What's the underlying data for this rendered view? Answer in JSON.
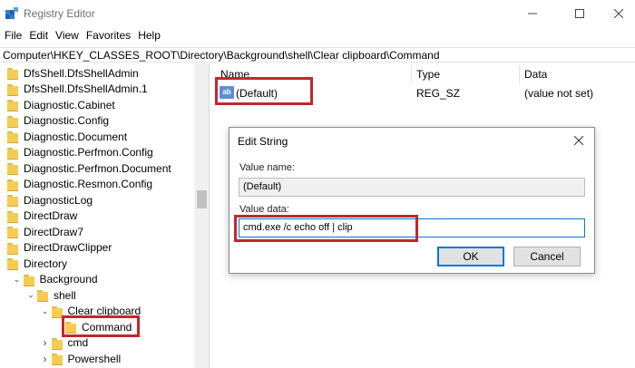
{
  "window": {
    "title": "Registry Editor"
  },
  "menu": [
    "File",
    "Edit",
    "View",
    "Favorites",
    "Help"
  ],
  "address": "Computer\\HKEY_CLASSES_ROOT\\Directory\\Background\\shell\\Clear clipboard\\Command",
  "tree": [
    {
      "label": "DfsShell.DfsShellAdmin",
      "depth": 0
    },
    {
      "label": "DfsShell.DfsShellAdmin.1",
      "depth": 0
    },
    {
      "label": "Diagnostic.Cabinet",
      "depth": 0
    },
    {
      "label": "Diagnostic.Config",
      "depth": 0
    },
    {
      "label": "Diagnostic.Document",
      "depth": 0
    },
    {
      "label": "Diagnostic.Perfmon.Config",
      "depth": 0
    },
    {
      "label": "Diagnostic.Perfmon.Document",
      "depth": 0
    },
    {
      "label": "Diagnostic.Resmon.Config",
      "depth": 0
    },
    {
      "label": "DiagnosticLog",
      "depth": 0
    },
    {
      "label": "DirectDraw",
      "depth": 0
    },
    {
      "label": "DirectDraw7",
      "depth": 0
    },
    {
      "label": "DirectDrawClipper",
      "depth": 0
    },
    {
      "label": "Directory",
      "depth": 0
    },
    {
      "label": "Background",
      "depth": 1,
      "expanded": true
    },
    {
      "label": "shell",
      "depth": 2,
      "expanded": true
    },
    {
      "label": "Clear clipboard",
      "depth": 3,
      "expanded": true
    },
    {
      "label": "Command",
      "depth": 4,
      "selected": true
    },
    {
      "label": "cmd",
      "depth": 3,
      "collapsed": true
    },
    {
      "label": "Powershell",
      "depth": 3,
      "collapsed": true
    }
  ],
  "list": {
    "columns": [
      "Name",
      "Type",
      "Data"
    ],
    "rows": [
      {
        "name": "(Default)",
        "type": "REG_SZ",
        "data": "(value not set)",
        "icon": "ab"
      }
    ]
  },
  "dialog": {
    "title": "Edit String",
    "value_name_label": "Value name:",
    "value_name": "(Default)",
    "value_data_label": "Value data:",
    "value_data": "cmd.exe /c echo off | clip",
    "ok_label": "OK",
    "cancel_label": "Cancel"
  },
  "colors": {
    "highlight": "#c4262e",
    "accent": "#0078d7",
    "folder": "#f4cc54"
  }
}
